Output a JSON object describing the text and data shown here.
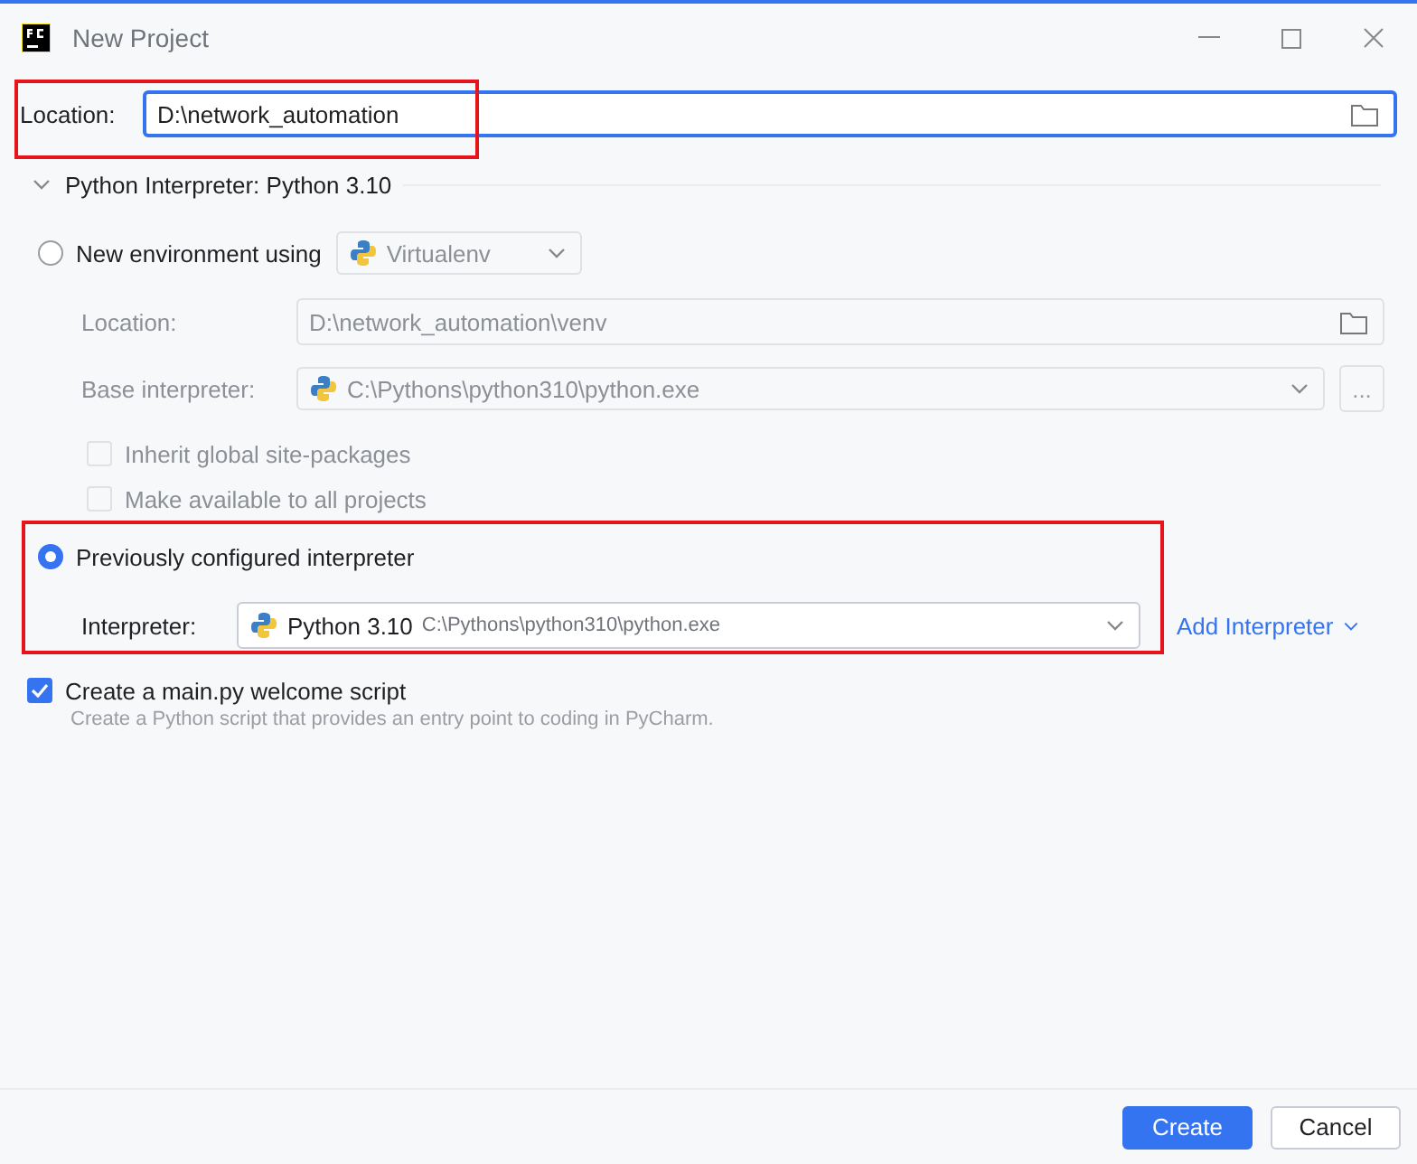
{
  "window": {
    "title": "New Project"
  },
  "location": {
    "label": "Location:",
    "value": "D:\\network_automation"
  },
  "interpreter_section": {
    "title": "Python Interpreter: Python 3.10",
    "expanded": true
  },
  "new_environment": {
    "label": "New environment using",
    "selected": false,
    "tool": "Virtualenv",
    "location_label": "Location:",
    "location": "D:\\network_automation\\venv",
    "base_label": "Base interpreter:",
    "base": "C:\\Pythons\\python310\\python.exe",
    "browse": "...",
    "options": [
      {
        "label": "Inherit global site-packages",
        "checked": false
      },
      {
        "label": "Make available to all projects",
        "checked": false
      }
    ]
  },
  "previous": {
    "label": "Previously configured interpreter",
    "selected": true,
    "interpreter_label": "Interpreter:",
    "name": "Python 3.10",
    "path": "C:\\Pythons\\python310\\python.exe",
    "add": "Add Interpreter"
  },
  "welcome": {
    "label": "Create a main.py welcome script",
    "checked": true,
    "hint": "Create a Python script that provides an entry point to coding in PyCharm."
  },
  "buttons": [
    {
      "label": "Create",
      "kind": "primary"
    },
    {
      "label": "Cancel",
      "kind": "secondary"
    }
  ]
}
